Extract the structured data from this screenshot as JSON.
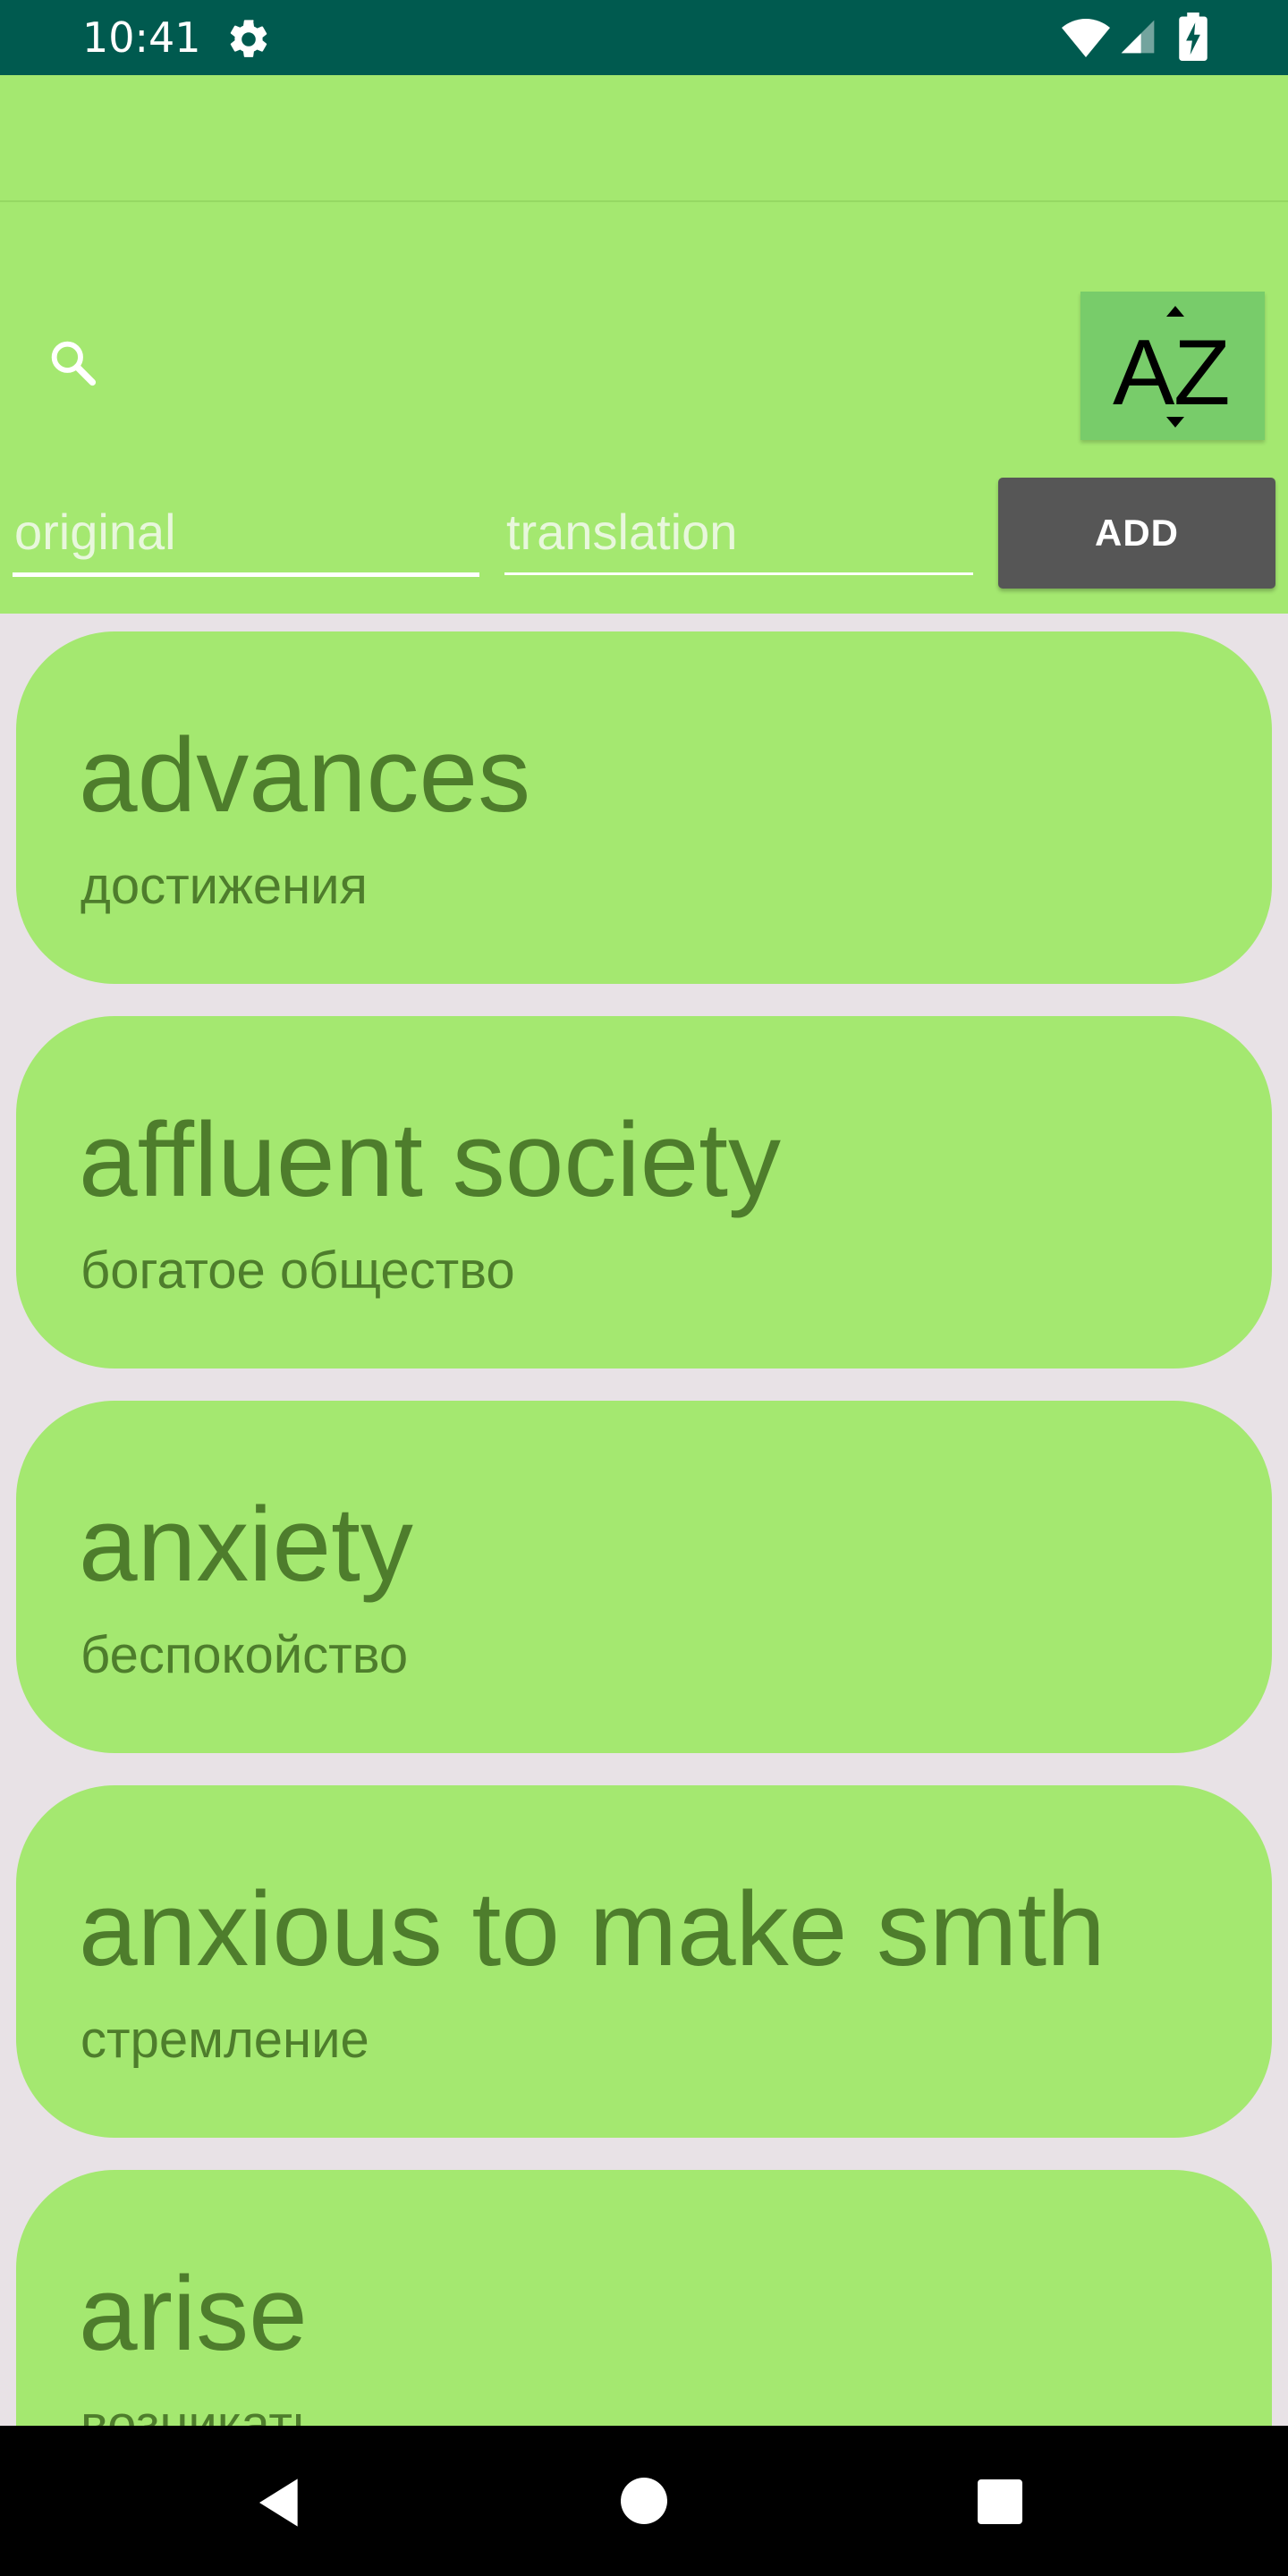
{
  "status_bar": {
    "time": "10:41",
    "icons": [
      "gear-icon",
      "wifi-icon",
      "signal-icon",
      "battery-charging-icon"
    ],
    "background": "#005a4f"
  },
  "toolbar": {
    "background": "#a4e870"
  },
  "controls": {
    "search_icon": "search-icon",
    "sort_icon": "sort-az-icon",
    "original": {
      "placeholder": "original",
      "value": ""
    },
    "translation": {
      "placeholder": "translation",
      "value": ""
    },
    "add_label": "ADD"
  },
  "words": [
    {
      "original": "advances",
      "translation": "достижения"
    },
    {
      "original": "affluent society",
      "translation": "богатое общество"
    },
    {
      "original": "anxiety",
      "translation": "беспокойство"
    },
    {
      "original": "anxious to make smth",
      "translation": "стремление"
    },
    {
      "original": "arise",
      "translation": "возникать"
    }
  ],
  "colors": {
    "accent_green": "#a4e870",
    "text_green": "#4e7d2c",
    "button_gray": "#565656",
    "list_background": "#e8e2e6"
  },
  "nav_bar": {
    "icons": [
      "back-icon",
      "home-icon",
      "recents-icon"
    ]
  }
}
